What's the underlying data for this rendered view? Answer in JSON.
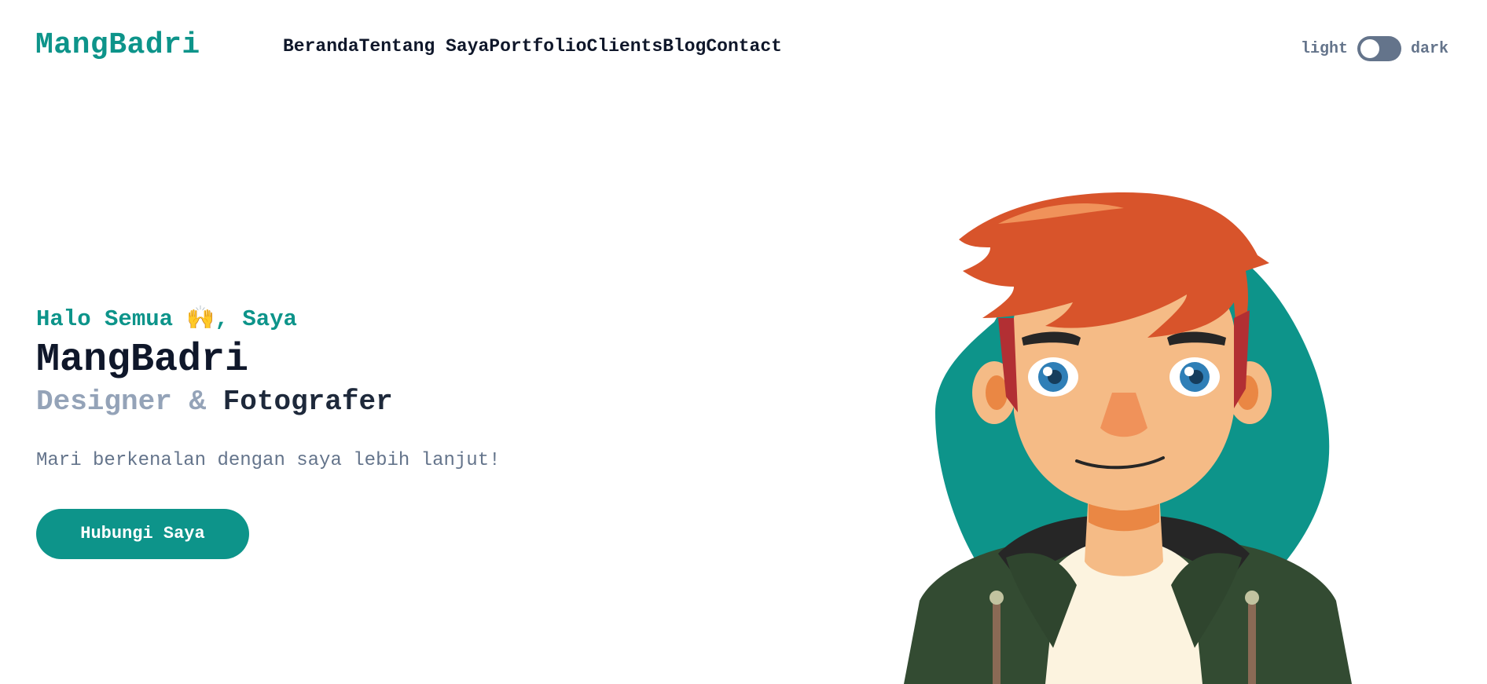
{
  "brand": {
    "name": "MangBadri"
  },
  "nav": {
    "items": [
      {
        "label": "Beranda"
      },
      {
        "label": "Tentang Saya"
      },
      {
        "label": "Portfolio"
      },
      {
        "label": "Clients"
      },
      {
        "label": "Blog"
      },
      {
        "label": "Contact"
      }
    ]
  },
  "theme_toggle": {
    "light_label": "light",
    "dark_label": "dark",
    "state": "light"
  },
  "hero": {
    "greeting": "Halo Semua 🙌, Saya",
    "name": "MangBadri",
    "role_first": "Designer",
    "role_amp": "&",
    "role_second": "Fotografer",
    "description": "Mari berkenalan dengan saya lebih lanjut!",
    "cta_label": "Hubungi Saya"
  },
  "colors": {
    "accent": "#0d948a",
    "text_dark": "#0f172a",
    "muted": "#64748b",
    "toggle": "#64748b"
  },
  "illustration": {
    "icon": "avatar-illustration-icon"
  }
}
